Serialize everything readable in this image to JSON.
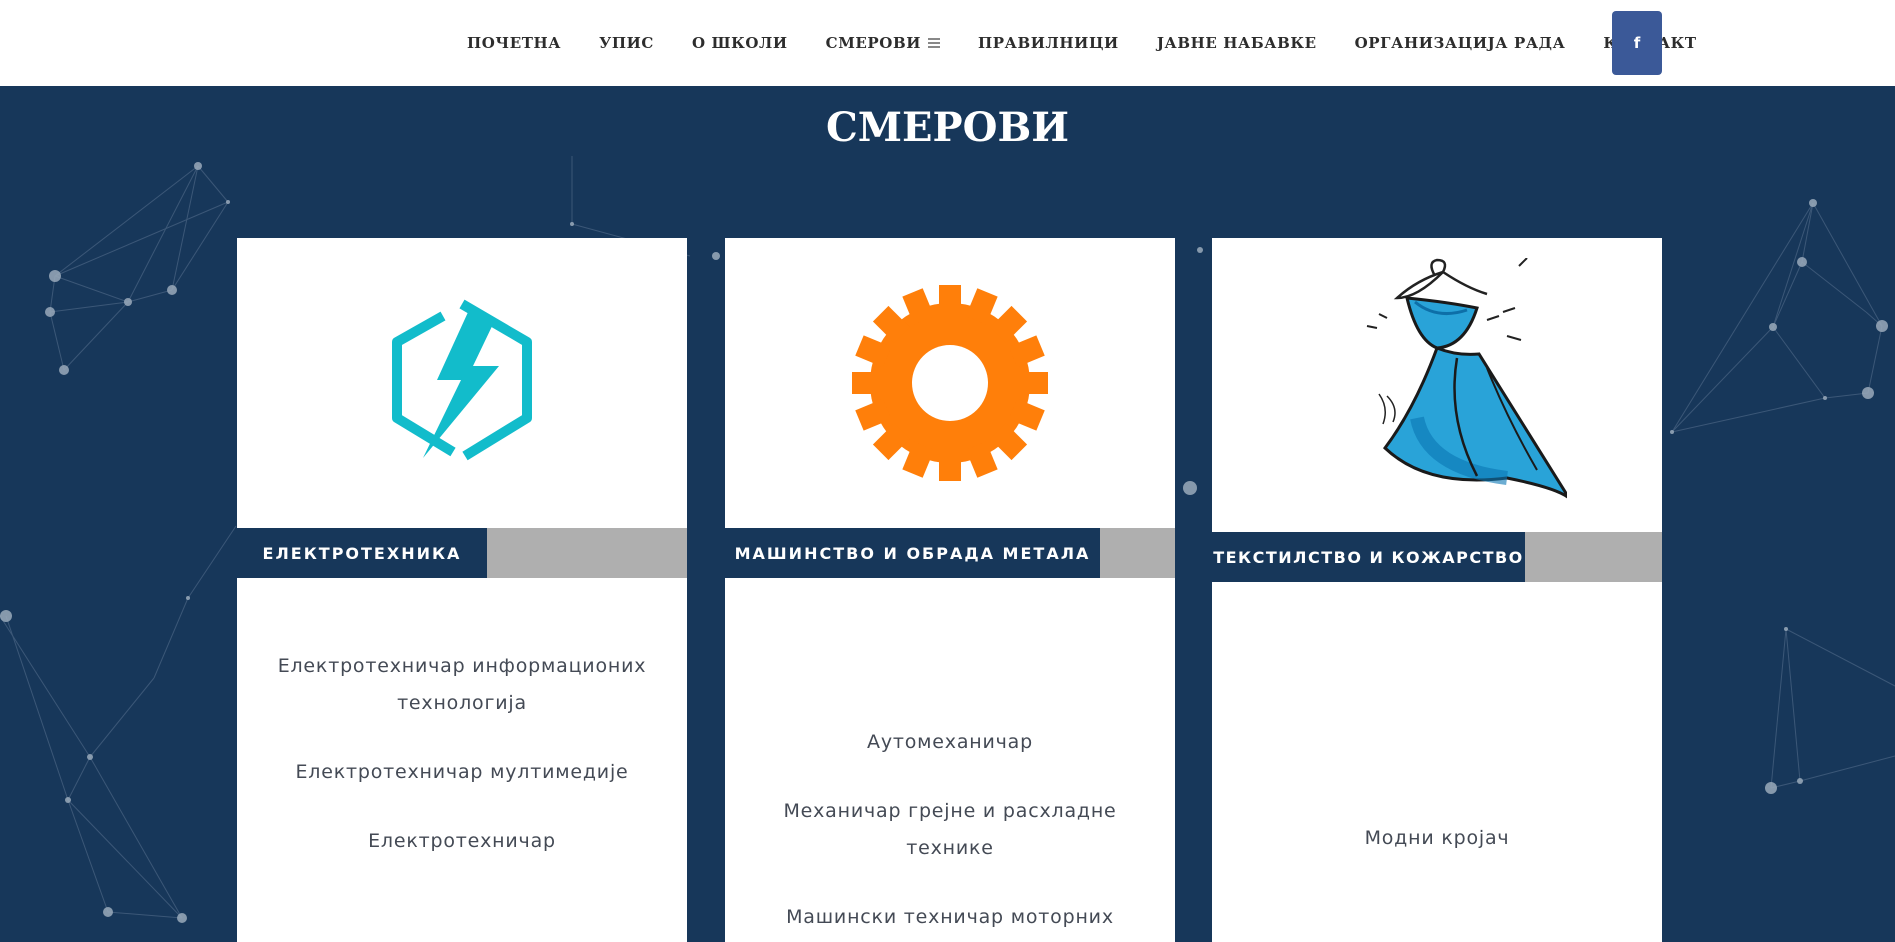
{
  "nav": {
    "items": [
      {
        "label": "ПОЧЕТНА"
      },
      {
        "label": "УПИС"
      },
      {
        "label": "О ШКОЛИ"
      },
      {
        "label": "СМЕРОВИ",
        "has_menu_icon": true
      },
      {
        "label": "ПРАВИЛНИЦИ"
      },
      {
        "label": "ЈАВНЕ НАБАВКЕ"
      },
      {
        "label": "ОРГАНИЗАЦИЈА РАДА"
      },
      {
        "label": "КОНТАКТ"
      }
    ],
    "facebook_label": "f",
    "facebook_color": "#3b5998"
  },
  "section": {
    "title": "СМЕРОВИ"
  },
  "cards": [
    {
      "icon": "lightning-hexagon-icon",
      "icon_color": "#12bccb",
      "label": "ЕЛЕКТРОТЕХНИКА",
      "courses": [
        "Електротехничар информационих технологија",
        "Електротехничар мултимедије",
        "Електротехничар"
      ]
    },
    {
      "icon": "gear-icon",
      "icon_color": "#ff7f0a",
      "label": "МАШИНСТВО И ОБРАДА МЕТАЛА",
      "courses": [
        "Аутомеханичар",
        "Механичар грејне и расхладне технике",
        "Машински техничар моторних"
      ]
    },
    {
      "icon": "dress-on-hanger-icon",
      "icon_color": "#29a3d8",
      "label": "ТЕКСТИЛСТВО И КОЖАРСТВО",
      "courses": [
        "Модни кројач"
      ]
    }
  ],
  "colors": {
    "navy": "#17375a",
    "label_gray": "#afafaf"
  }
}
